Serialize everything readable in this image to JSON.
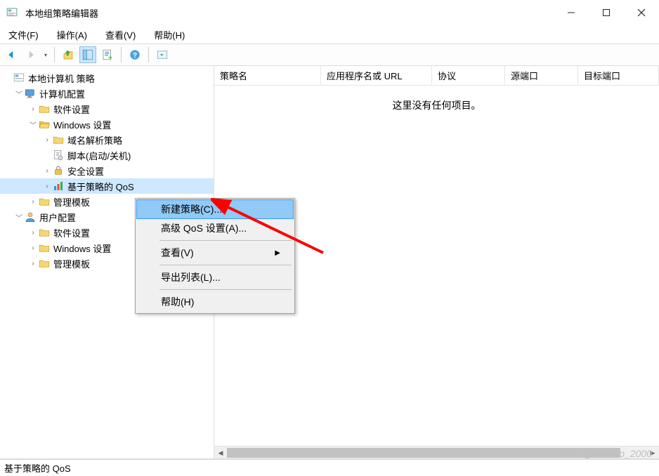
{
  "window": {
    "title": "本地组策略编辑器"
  },
  "menubar": {
    "file": "文件(F)",
    "action": "操作(A)",
    "view": "查看(V)",
    "help": "帮助(H)"
  },
  "tree": {
    "root": "本地计算机 策略",
    "computer": "计算机配置",
    "soft1": "软件设置",
    "win1": "Windows 设置",
    "dns": "域名解析策略",
    "script": "脚本(启动/关机)",
    "security": "安全设置",
    "qos": "基于策略的 QoS",
    "admin1": "管理模板",
    "user": "用户配置",
    "soft2": "软件设置",
    "win2": "Windows 设置",
    "admin2": "管理模板"
  },
  "columns": {
    "c1": "策略名",
    "c2": "应用程序名或 URL",
    "c3": "协议",
    "c4": "源端口",
    "c5": "目标端口"
  },
  "empty": "这里没有任何项目。",
  "context": {
    "new": "新建策略(C)...",
    "adv": "高级 QoS 设置(A)...",
    "view": "查看(V)",
    "export": "导出列表(L)...",
    "help": "帮助(H)"
  },
  "status": "基于策略的 QoS",
  "watermark": "CSDN @oldmao_2000"
}
